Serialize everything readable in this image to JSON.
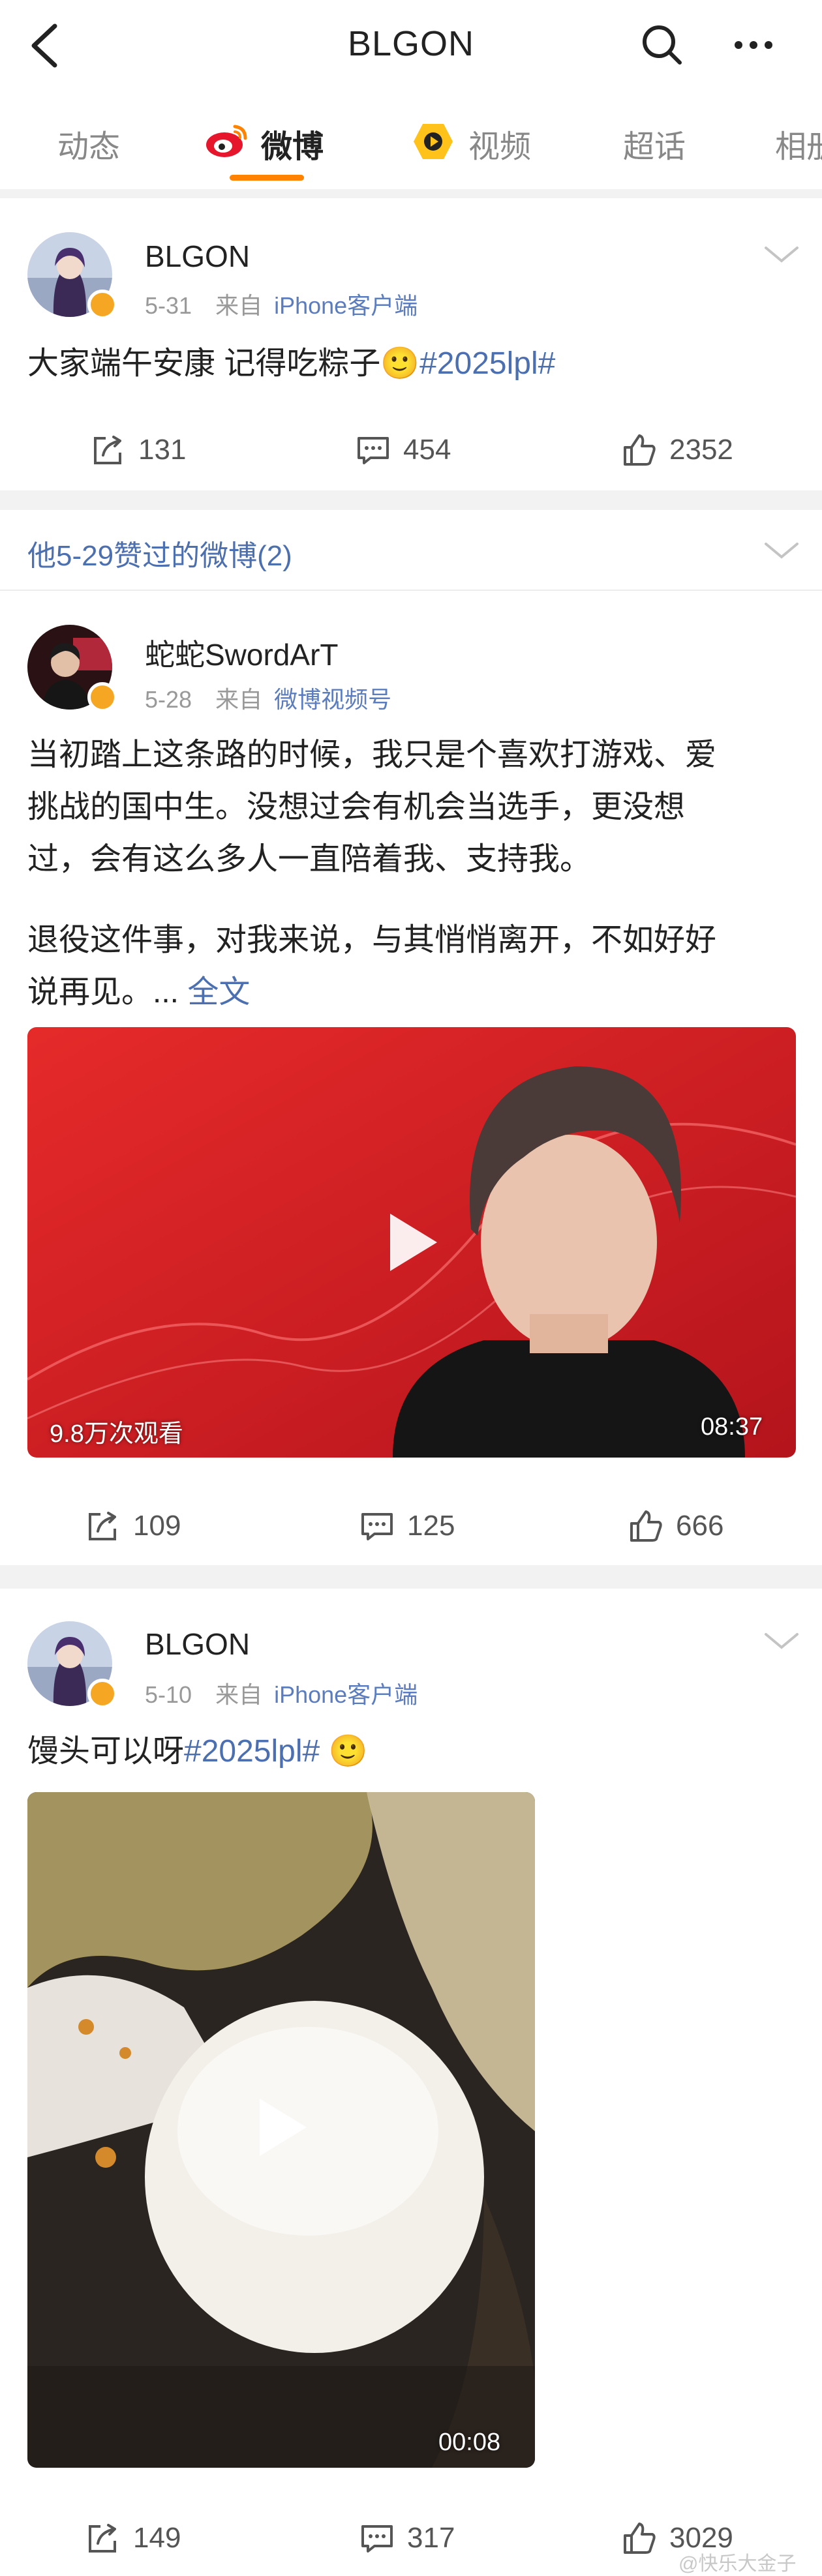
{
  "header": {
    "title": "BLGON",
    "back_icon": "chevron-left-icon",
    "search_icon": "search-icon",
    "more_icon": "more-horizontal-icon"
  },
  "tabs": [
    {
      "label": "动态",
      "active": false
    },
    {
      "label": "微博",
      "active": true
    },
    {
      "label": "视频",
      "active": false
    },
    {
      "label": "超话",
      "active": false
    },
    {
      "label": "相册",
      "active": false
    }
  ],
  "accent_color": "#ff8200",
  "link_color": "#4c6fb0",
  "posts": [
    {
      "user": "BLGON",
      "date": "5-31",
      "source_prefix": "来自",
      "source": "iPhone客户端",
      "text": "大家端午安康 记得吃粽子",
      "emoji": "🙂",
      "topic": "#2025lpl#",
      "reposts": "131",
      "comments": "454",
      "likes": "2352"
    }
  ],
  "liked_section": {
    "title": "他5-29赞过的微博(2)"
  },
  "liked_post": {
    "user": "蛇蛇SwordArT",
    "date": "5-28",
    "source_prefix": "来自",
    "source": "微博视频号",
    "lines": [
      "当初踏上这条路的时候，我只是个喜欢打游戏、爱",
      "挑战的国中生。没想过会有机会当选手，更没想",
      "过，会有这么多人一直陪着我、支持我。",
      "退役这件事，对我来说，与其悄悄离开，不如好好",
      "说再见。..."
    ],
    "full_text_link": "全文",
    "video_views": "9.8万次观看",
    "video_duration": "08:37",
    "reposts": "109",
    "comments": "125",
    "likes": "666"
  },
  "post3": {
    "user": "BLGON",
    "date": "5-10",
    "source_prefix": "来自",
    "source": "iPhone客户端",
    "text": "馒头可以呀",
    "topic": "#2025lpl#",
    "emoji": "🙂",
    "video_duration": "00:08",
    "reposts": "149",
    "comments": "317",
    "likes": "3029"
  },
  "watermark": "@快乐大金子"
}
